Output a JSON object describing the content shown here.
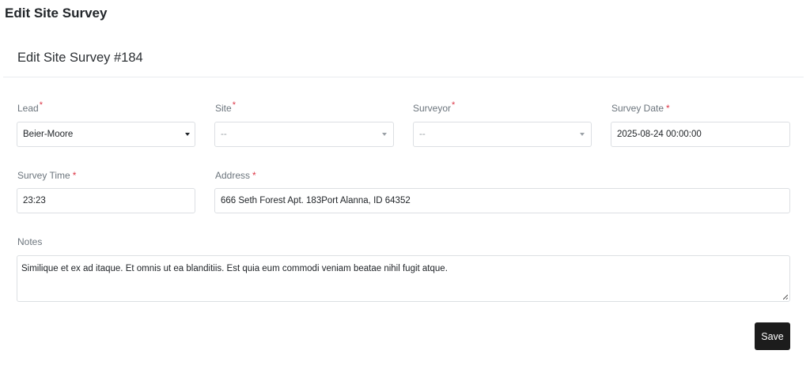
{
  "page": {
    "heading": "Edit Site Survey",
    "card_title": "Edit Site Survey #184"
  },
  "form": {
    "lead": {
      "label": "Lead",
      "required_mark": "*",
      "value": "Beier-Moore"
    },
    "site": {
      "label": "Site",
      "required_mark": "*",
      "value": "--"
    },
    "surveyor": {
      "label": "Surveyor",
      "required_mark": "*",
      "value": "--"
    },
    "survey_date": {
      "label": "Survey Date",
      "required_mark": "*",
      "value": "2025-08-24 00:00:00"
    },
    "survey_time": {
      "label": "Survey Time",
      "required_mark": "*",
      "value": "23:23"
    },
    "address": {
      "label": "Address",
      "required_mark": "*",
      "value": "666 Seth Forest Apt. 183Port Alanna, ID 64352"
    },
    "notes": {
      "label": "Notes",
      "value": "Similique et ex ad itaque. Et omnis ut ea blanditiis. Est quia eum commodi veniam beatae nihil fugit atque."
    }
  },
  "actions": {
    "save_label": "Save"
  },
  "colors": {
    "required": "#dc3545",
    "save_button": "#1c1c1c",
    "border": "#dcdfe3"
  }
}
